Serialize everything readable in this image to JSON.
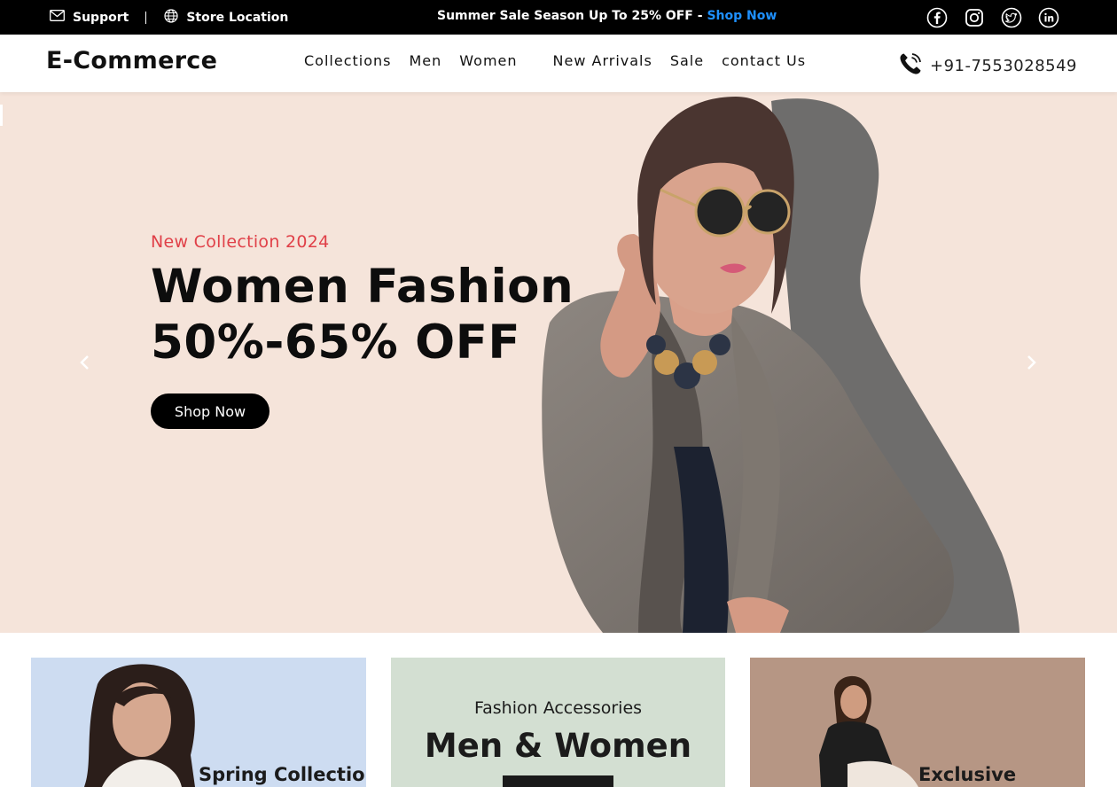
{
  "topbar": {
    "support_label": "Support",
    "store_location_label": "Store Location",
    "announcement_text": "Summer Sale Season Up To 25% OFF - ",
    "announcement_link": "Shop Now",
    "social": [
      "facebook-icon",
      "instagram-icon",
      "twitter-icon",
      "linkedin-icon"
    ]
  },
  "header": {
    "brand": "E-Commerce",
    "nav": [
      "Collections",
      "Men",
      "Women",
      "New Arrivals",
      "Sale",
      "contact Us"
    ],
    "phone": "+91-7553028549"
  },
  "hero": {
    "eyebrow": "New Collection 2024",
    "title_line1": "Women Fashion",
    "title_line2": "50%-65% OFF",
    "cta": "Shop Now"
  },
  "cards": {
    "card1_label": "Spring Collection",
    "card2_kicker": "Fashion Accessories",
    "card2_title": "Men & Women",
    "card3_label": "Exclusive"
  },
  "colors": {
    "topbar_bg": "#000000",
    "accent_link": "#1e90ff",
    "hero_bg": "#f5e4da",
    "eyebrow": "#e04048",
    "card1_bg": "#cddcf1",
    "card2_bg": "#d3dfd2",
    "card3_bg": "#b59582"
  }
}
